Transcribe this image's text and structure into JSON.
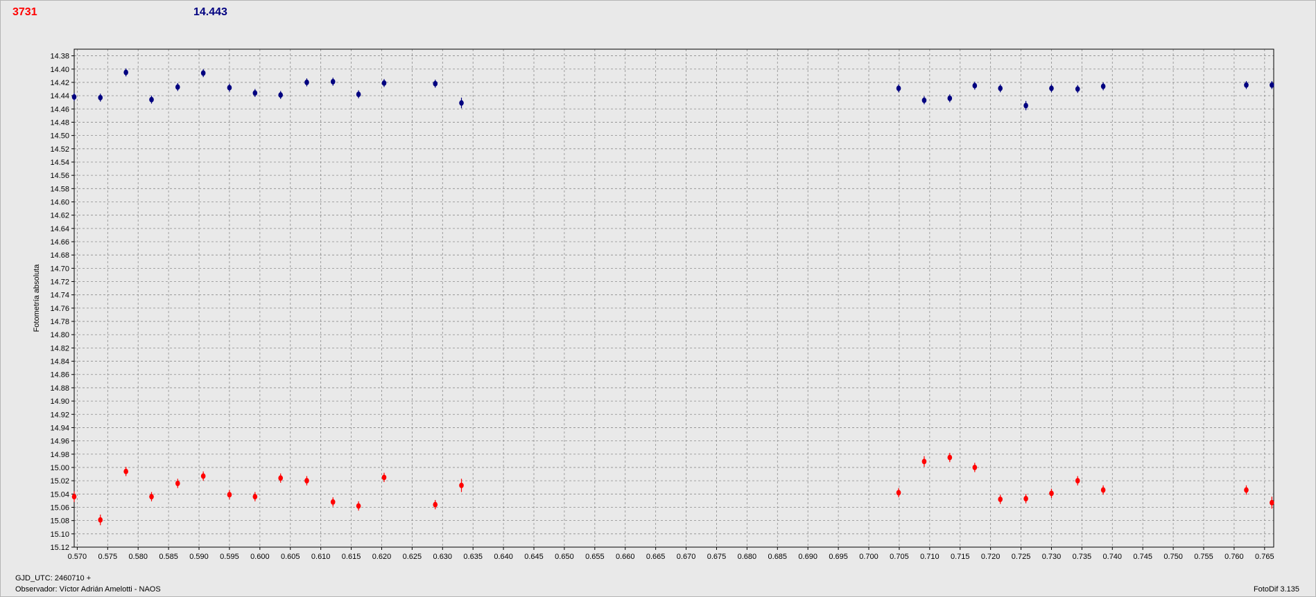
{
  "header": {
    "left_value": "3731",
    "left_color": "#ff0000",
    "right_value": "14.443",
    "right_color": "#000080"
  },
  "footer": {
    "gjd": "GJD_UTC: 2460710 +",
    "observer": "Observador: Víctor Adrián Amelotti - NAOS",
    "version": "FotoDif 3.135"
  },
  "chart_data": {
    "type": "scatter",
    "ylabel": "Fotometría absoluta",
    "xlabel": "",
    "xlim": [
      0.5695,
      0.7665
    ],
    "ylim": [
      15.12,
      14.37
    ],
    "y_inverted": true,
    "grid": true,
    "x_ticks": [
      "0.570",
      "0.575",
      "0.580",
      "0.585",
      "0.590",
      "0.595",
      "0.600",
      "0.605",
      "0.610",
      "0.615",
      "0.620",
      "0.625",
      "0.630",
      "0.635",
      "0.640",
      "0.645",
      "0.650",
      "0.655",
      "0.660",
      "0.665",
      "0.670",
      "0.675",
      "0.680",
      "0.685",
      "0.690",
      "0.695",
      "0.700",
      "0.705",
      "0.710",
      "0.715",
      "0.720",
      "0.725",
      "0.730",
      "0.735",
      "0.740",
      "0.745",
      "0.750",
      "0.755",
      "0.760",
      "0.765"
    ],
    "y_ticks": [
      "14.38",
      "14.40",
      "14.42",
      "14.44",
      "14.46",
      "14.48",
      "14.50",
      "14.52",
      "14.54",
      "14.56",
      "14.58",
      "14.60",
      "14.62",
      "14.64",
      "14.66",
      "14.68",
      "14.70",
      "14.72",
      "14.74",
      "14.76",
      "14.78",
      "14.80",
      "14.82",
      "14.84",
      "14.86",
      "14.88",
      "14.90",
      "14.92",
      "14.94",
      "14.96",
      "14.98",
      "15.00",
      "15.02",
      "15.04",
      "15.06",
      "15.08",
      "15.10",
      "15.12"
    ],
    "series": [
      {
        "color": "#000080",
        "x": [
          0.5695,
          0.5738,
          0.578,
          0.5822,
          0.5865,
          0.5907,
          0.595,
          0.5992,
          0.6034,
          0.6077,
          0.612,
          0.6162,
          0.6204,
          0.6288,
          0.6331,
          0.7049,
          0.7091,
          0.7133,
          0.7174,
          0.7216,
          0.7258,
          0.73,
          0.7343,
          0.7385,
          0.762,
          0.7662
        ],
        "y": [
          14.442,
          14.443,
          14.405,
          14.446,
          14.427,
          14.406,
          14.428,
          14.436,
          14.439,
          14.42,
          14.419,
          14.438,
          14.421,
          14.422,
          14.451,
          14.429,
          14.447,
          14.444,
          14.425,
          14.429,
          14.455,
          14.429,
          14.43,
          14.426,
          14.424,
          14.424
        ],
        "err": [
          0.006,
          0.006,
          0.006,
          0.006,
          0.006,
          0.006,
          0.006,
          0.006,
          0.006,
          0.006,
          0.006,
          0.006,
          0.006,
          0.006,
          0.008,
          0.006,
          0.006,
          0.006,
          0.006,
          0.006,
          0.007,
          0.006,
          0.006,
          0.006,
          0.006,
          0.006
        ]
      },
      {
        "color": "#ff0000",
        "x": [
          0.5695,
          0.5738,
          0.578,
          0.5822,
          0.5865,
          0.5907,
          0.595,
          0.5992,
          0.6034,
          0.6077,
          0.612,
          0.6162,
          0.6204,
          0.6288,
          0.6331,
          0.7049,
          0.7091,
          0.7133,
          0.7174,
          0.7216,
          0.7258,
          0.73,
          0.7343,
          0.7385,
          0.762,
          0.7662
        ],
        "y": [
          15.044,
          15.079,
          15.006,
          15.044,
          15.024,
          15.013,
          15.041,
          15.044,
          15.016,
          15.02,
          15.052,
          15.058,
          15.015,
          15.056,
          15.027,
          15.038,
          14.991,
          14.985,
          15.0,
          15.048,
          15.047,
          15.039,
          15.02,
          15.034,
          15.034,
          15.053
        ],
        "err": [
          0.008,
          0.008,
          0.007,
          0.007,
          0.007,
          0.007,
          0.007,
          0.007,
          0.007,
          0.007,
          0.007,
          0.007,
          0.007,
          0.007,
          0.01,
          0.007,
          0.008,
          0.007,
          0.007,
          0.007,
          0.007,
          0.007,
          0.007,
          0.007,
          0.007,
          0.009
        ]
      }
    ]
  }
}
